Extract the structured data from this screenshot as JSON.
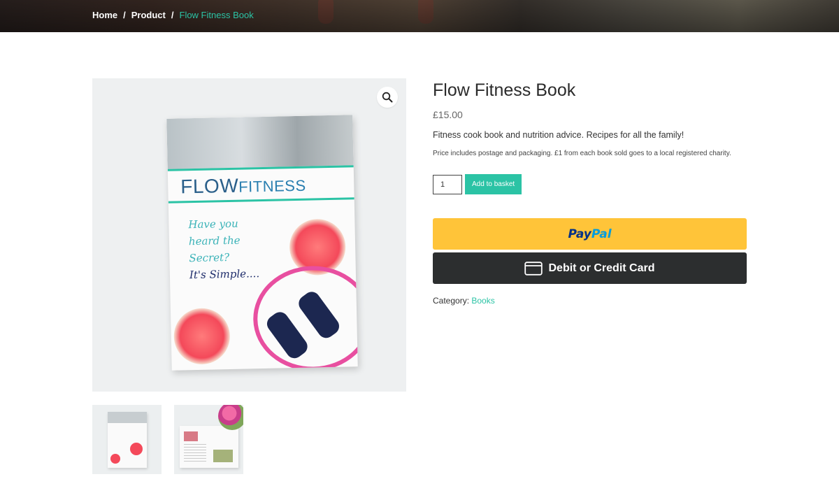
{
  "breadcrumb": {
    "items": [
      "Home",
      "Product"
    ],
    "separator": "/",
    "current": "Flow Fitness Book"
  },
  "gallery": {
    "zoom_icon": "magnifier-icon",
    "cover": {
      "logo_bold": "FLOW",
      "logo_lite": "FITNESS",
      "script_lines": [
        "Have you",
        "heard the",
        "Secret?"
      ],
      "script_dark": "It's Simple...."
    },
    "thumbnails": [
      "book-cover-thumbnail",
      "book-inside-thumbnail"
    ]
  },
  "product": {
    "title": "Flow Fitness Book",
    "price": "£15.00",
    "short_description": "Fitness cook book and nutrition advice. Recipes for all the family!",
    "note": "Price includes postage and packaging. £1 from each book sold goes to a local registered charity.",
    "quantity": "1",
    "add_to_basket_label": "Add to basket",
    "paypal_pay": "Pay",
    "paypal_pal": "Pal",
    "card_button_label": "Debit or Credit Card",
    "category_label": "Category:",
    "category_value": "Books"
  },
  "colors": {
    "accent": "#2bc3a5",
    "paypal_yellow": "#ffc439",
    "card_dark": "#2c2e2f"
  }
}
